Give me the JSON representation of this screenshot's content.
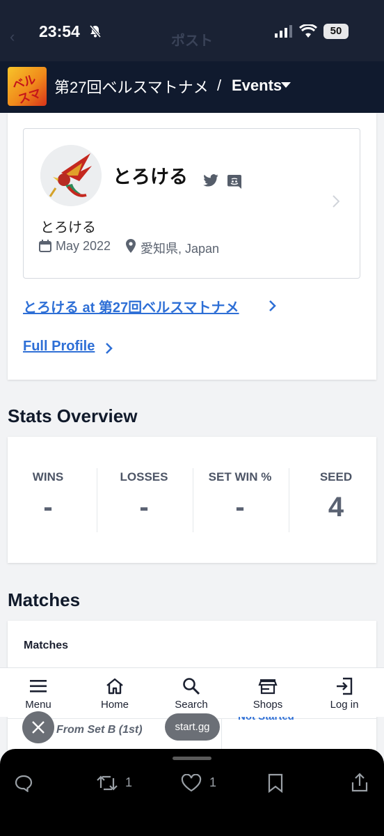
{
  "status_bar": {
    "time": "23:54",
    "battery": "50",
    "background_title": "ポスト"
  },
  "header": {
    "event_title": "第27回ベルスマトナメ",
    "separator": "/",
    "events_label": "Events"
  },
  "event_logo_text": "ベルスマ",
  "profile": {
    "gamer_tag": "とろける",
    "real_name": "とろける",
    "joined": "May 2022",
    "location": "愛知県, Japan",
    "entrant_link": "とろける at 第27回ベルスマトナメ",
    "full_profile_link": "Full Profile"
  },
  "stats": {
    "title": "Stats Overview",
    "items": [
      {
        "label": "WINS",
        "value": "-"
      },
      {
        "label": "LOSSES",
        "value": "-"
      },
      {
        "label": "SET WIN %",
        "value": "-"
      },
      {
        "label": "SEED",
        "value": "4"
      }
    ]
  },
  "matches": {
    "title": "Matches",
    "card_heading": "Matches",
    "row_from": "From Set B (1st)",
    "row_status": "Not Started"
  },
  "bottom_nav": [
    {
      "label": "Menu",
      "icon": "menu-icon"
    },
    {
      "label": "Home",
      "icon": "home-icon"
    },
    {
      "label": "Search",
      "icon": "search-icon"
    },
    {
      "label": "Shops",
      "icon": "shop-icon"
    },
    {
      "label": "Log in",
      "icon": "login-icon"
    }
  ],
  "toast": "start.gg",
  "x_actions": {
    "retweets": "1",
    "likes": "1"
  },
  "colors": {
    "header_bg": "#101a2e",
    "link": "#2e6fd6",
    "page_bg": "#f2f3f5"
  }
}
